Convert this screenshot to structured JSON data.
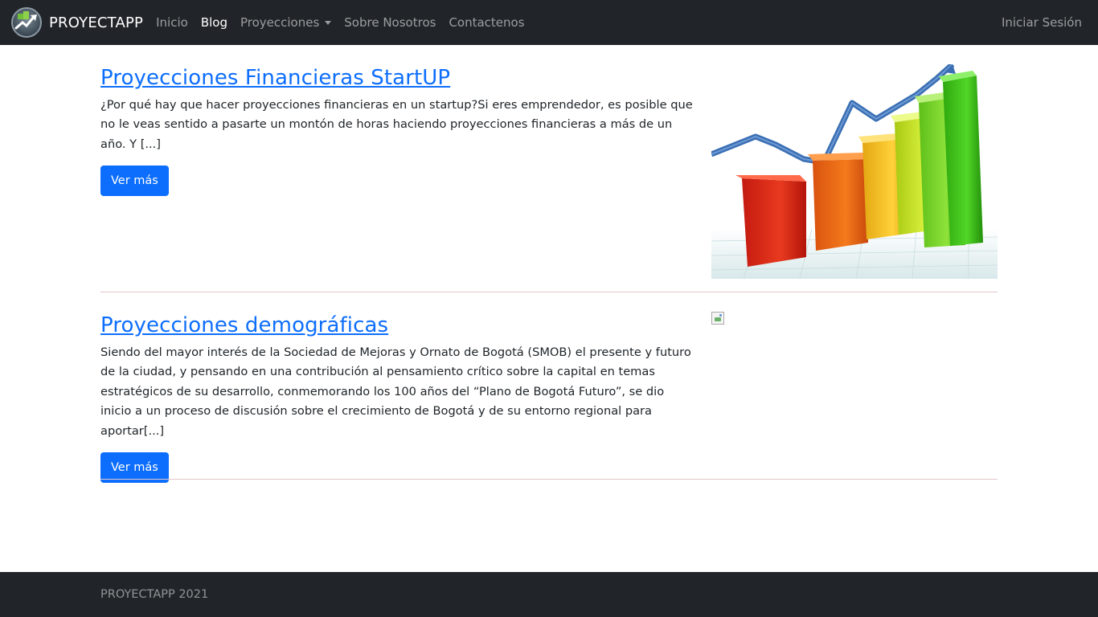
{
  "navbar": {
    "brand": "PROYECTAPP",
    "links": [
      {
        "label": "Inicio"
      },
      {
        "label": "Blog"
      },
      {
        "label": "Proyecciones"
      },
      {
        "label": "Sobre Nosotros"
      },
      {
        "label": "Contactenos"
      }
    ],
    "login": "Iniciar Sesión",
    "active": "Blog"
  },
  "posts": [
    {
      "title": "Proyecciones Financieras StartUP",
      "excerpt": "¿Por qué hay que hacer proyecciones financieras en un startup?Si eres emprendedor, es posible que no le veas sentido a pasarte un montón de horas haciendo proyecciones financieras a más de un año. Y [...]",
      "button": "Ver más",
      "image": "bar-chart-growth-image"
    },
    {
      "title": "Proyecciones demográficas",
      "excerpt": "Siendo del mayor interés de la Sociedad de Mejoras y Ornato de Bogotá (SMOB) el presente y futuro de la ciudad, y pensando en una contribución al pensamiento crítico sobre la capital en temas estratégicos de su desarrollo, conmemorando los 100 años del “Plano de Bogotá Futuro”, se dio inicio a un proceso de discusión sobre el crecimiento de Bogotá y de su entorno regional para aportar[...]",
      "button": "Ver más",
      "image": "broken-image-icon"
    }
  ],
  "footer": {
    "text": "PROYECTAPP 2021"
  },
  "colors": {
    "navbar_bg": "#212529",
    "link_blue": "#0d6efd",
    "divider": "#e3c7c9"
  }
}
